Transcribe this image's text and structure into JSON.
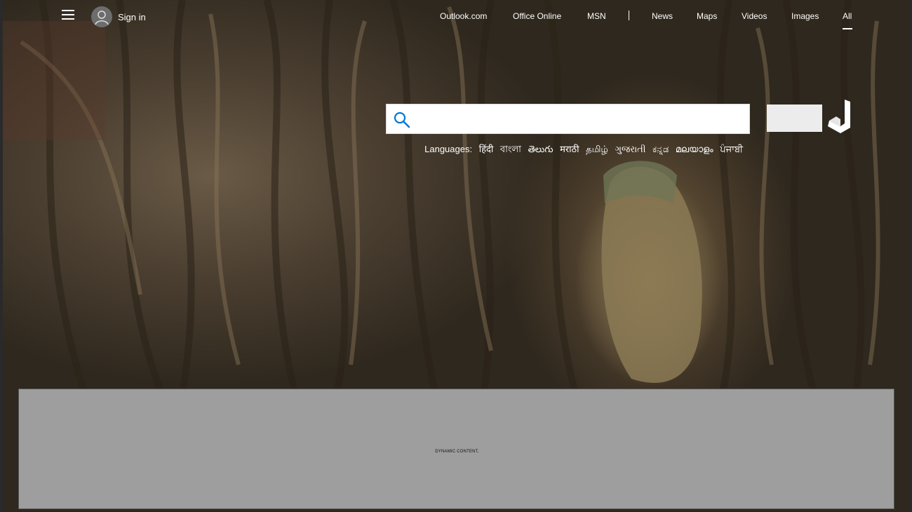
{
  "header": {
    "sign_in": "Sign in",
    "nav": [
      {
        "label": "All",
        "active": true
      },
      {
        "label": "Images"
      },
      {
        "label": "Videos"
      },
      {
        "label": "Maps"
      },
      {
        "label": "News"
      },
      {
        "label": "MSN"
      },
      {
        "label": "Office Online"
      },
      {
        "label": "Outlook.com"
      }
    ]
  },
  "search": {
    "placeholder": "",
    "value": ""
  },
  "languages": {
    "label": "Languages:",
    "items": [
      "हिंदी",
      "বাংলা",
      "తెలుగు",
      "मराठी",
      "தமிழ்",
      "ગુજરાતી",
      "ಕನ್ನಡ",
      "മലയാളം",
      "ਪੰਜਾਬੀ"
    ]
  },
  "dynamic": {
    "label": "DYNAMIC CONTENT,"
  },
  "icons": {
    "menu": "hamburger-menu-icon",
    "avatar": "user-avatar-icon",
    "search": "search-icon",
    "logo": "bing-logo-icon"
  },
  "colors": {
    "accent": "#0078d4",
    "panel": "#9e9e9e"
  }
}
